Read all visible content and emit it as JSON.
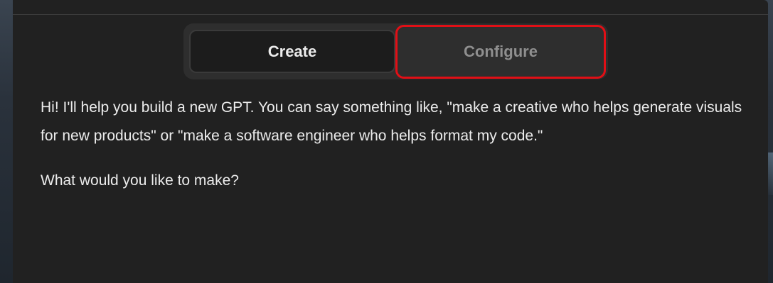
{
  "tabs": {
    "create_label": "Create",
    "configure_label": "Configure"
  },
  "message": {
    "intro": "Hi! I'll help you build a new GPT. You can say something like, \"make a creative who helps generate visuals for new products\" or \"make a software engineer who helps format my code.\"",
    "question": "What would you like to make?"
  },
  "colors": {
    "panel_background": "#212121",
    "highlight_border": "#e10f16",
    "active_tab": "#1c1c1c",
    "inactive_tab_text": "#8f8f8f"
  }
}
